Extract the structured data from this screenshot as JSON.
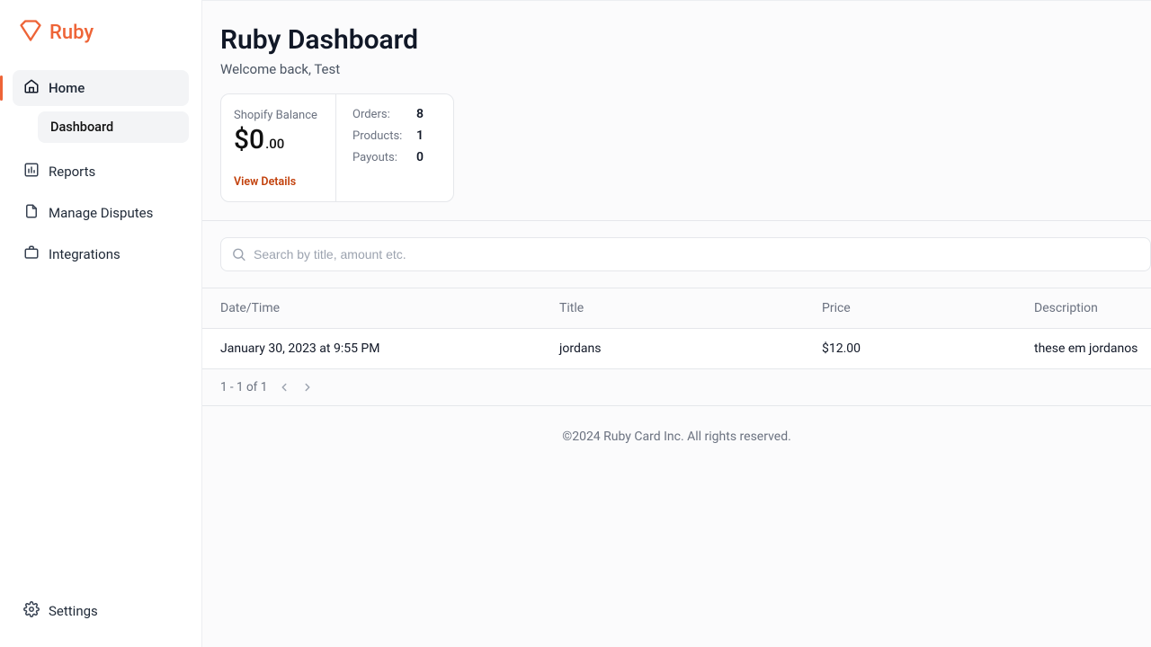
{
  "brand": {
    "name": "Ruby"
  },
  "sidebar": {
    "home": "Home",
    "dashboard": "Dashboard",
    "reports": "Reports",
    "manage_disputes": "Manage Disputes",
    "integrations": "Integrations",
    "settings": "Settings"
  },
  "header": {
    "title": "Ruby Dashboard",
    "welcome": "Welcome back, Test"
  },
  "stats": {
    "balance_label": "Shopify Balance",
    "balance_major": "$0",
    "balance_minor": ".00",
    "view_details": "View Details",
    "orders_label": "Orders:",
    "orders_value": "8",
    "products_label": "Products:",
    "products_value": "1",
    "payouts_label": "Payouts:",
    "payouts_value": "0"
  },
  "search": {
    "placeholder": "Search by title, amount etc."
  },
  "table": {
    "cols": {
      "datetime": "Date/Time",
      "title": "Title",
      "price": "Price",
      "description": "Description"
    },
    "rows": [
      {
        "datetime": "January 30, 2023 at 9:55 PM",
        "title": "jordans",
        "price": "$12.00",
        "description": "these em jordanos"
      }
    ]
  },
  "pager": {
    "label": "1 - 1 of 1"
  },
  "footer": {
    "copyright": "©2024 Ruby Card Inc. All rights reserved."
  }
}
